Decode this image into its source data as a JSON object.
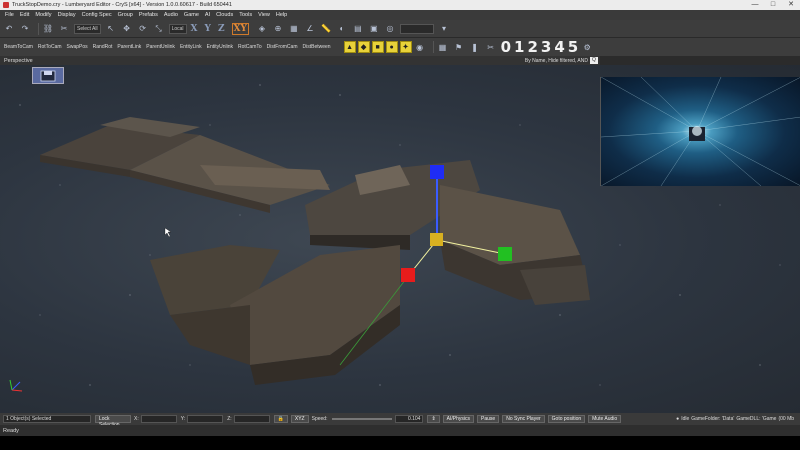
{
  "window": {
    "title": "TruckStopDemo.cry - Lumberyard Editor - CryS [x64] - Version 1.0.0.60617 - Build 650441",
    "min_glyph": "—",
    "max_glyph": "□",
    "close_glyph": "✕"
  },
  "menu": [
    "File",
    "Edit",
    "Modify",
    "Display",
    "Config Spec",
    "Group",
    "Prefabs",
    "Audio",
    "Game",
    "AI",
    "Clouds",
    "Tools",
    "View",
    "Help"
  ],
  "toolbar1": {
    "select_all": "Select All",
    "coord_system": "Local",
    "axes": [
      "X",
      "Y",
      "Z",
      "XY"
    ],
    "active_axis": "XY"
  },
  "toolbar2": {
    "commands": [
      "BeamToCam",
      "RotToCam",
      "SwapPos",
      "RandRot",
      "ParentLink",
      "ParentUnlink",
      "EntityLink",
      "EntityUnlink",
      "RotCamTo",
      "DistFromCam",
      "DistBetween"
    ],
    "digits": [
      "0",
      "1",
      "2",
      "3",
      "4",
      "5"
    ]
  },
  "viewport": {
    "title": "Perspective",
    "filter_text": "By Name, Hide filtered, AND",
    "search_glyph": "Q"
  },
  "status": {
    "selection": "1 Object(s) Selected",
    "lock_selection": "Lock Selection",
    "x_label": "X:",
    "y_label": "Y:",
    "z_label": "Z:",
    "xyz_label": "XYZ",
    "speed_label": "Speed:",
    "speed_value": "0.104",
    "ai_physics": "AI/Physics",
    "pause": "Pause",
    "no_sync_player": "No Sync Player",
    "goto_position": "Goto position",
    "mute_audio": "Mute Audio",
    "idle": "Idle",
    "gamefolder": "GameFolder: 'Data'",
    "gamedll": "GameDLL: 'Game",
    "mem": "(00 Mb"
  },
  "ready": {
    "text": "Ready",
    "game_info": "GameFolder: 'Data' - GameDLL: 'Game - 00 Mb"
  }
}
